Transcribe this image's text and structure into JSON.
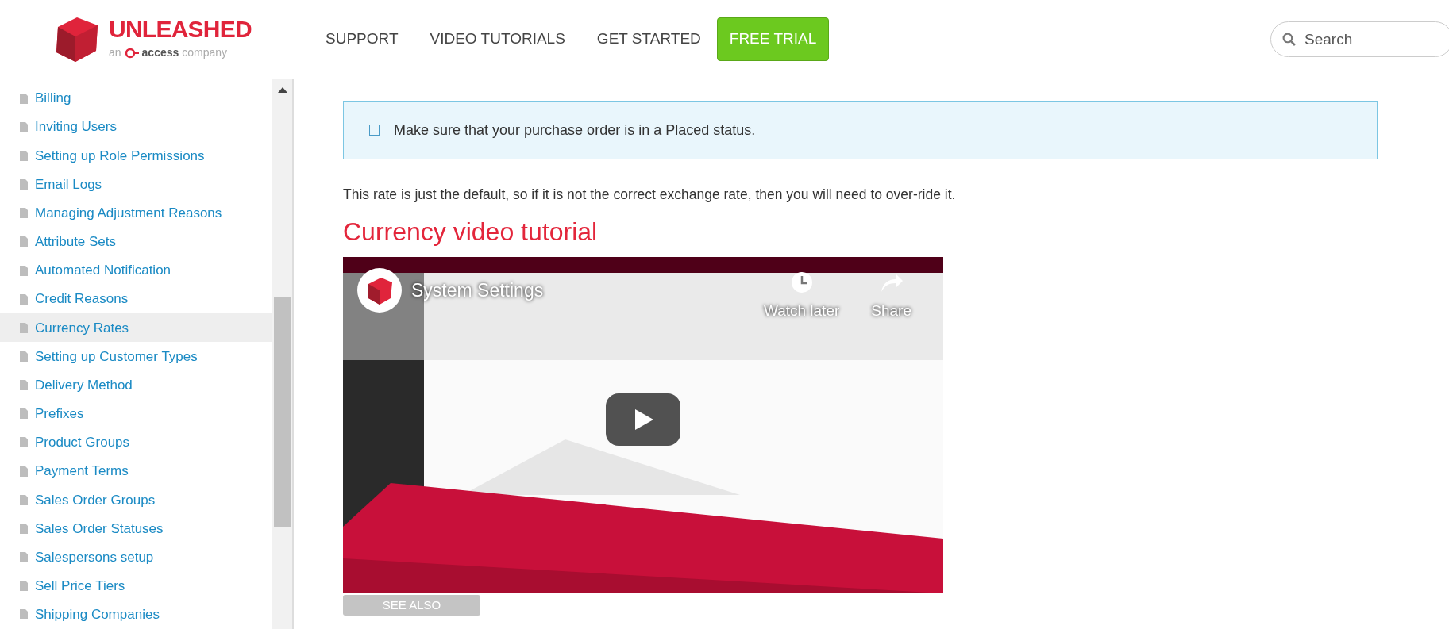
{
  "header": {
    "logo": {
      "name": "UNLEASHED",
      "tagline_pre": "an",
      "tagline_brand": "access",
      "tagline_post": "company"
    },
    "nav": [
      {
        "label": "SUPPORT",
        "kind": "link"
      },
      {
        "label": "VIDEO TUTORIALS",
        "kind": "link"
      },
      {
        "label": "GET STARTED",
        "kind": "link"
      },
      {
        "label": "FREE TRIAL",
        "kind": "cta"
      }
    ],
    "search": {
      "placeholder": "Search"
    }
  },
  "sidebar": {
    "items": [
      {
        "label": "Billing",
        "selected": false
      },
      {
        "label": "Inviting Users",
        "selected": false
      },
      {
        "label": "Setting up Role Permissions",
        "selected": false
      },
      {
        "label": "Email Logs",
        "selected": false
      },
      {
        "label": "Managing Adjustment Reasons",
        "selected": false
      },
      {
        "label": "Attribute Sets",
        "selected": false
      },
      {
        "label": "Automated Notification",
        "selected": false
      },
      {
        "label": "Credit Reasons",
        "selected": false
      },
      {
        "label": "Currency Rates",
        "selected": true
      },
      {
        "label": "Setting up Customer Types",
        "selected": false
      },
      {
        "label": "Delivery Method",
        "selected": false
      },
      {
        "label": "Prefixes",
        "selected": false
      },
      {
        "label": "Product Groups",
        "selected": false
      },
      {
        "label": "Payment Terms",
        "selected": false
      },
      {
        "label": "Sales Order Groups",
        "selected": false
      },
      {
        "label": "Sales Order Statuses",
        "selected": false
      },
      {
        "label": "Salespersons setup",
        "selected": false
      },
      {
        "label": "Sell Price Tiers",
        "selected": false
      },
      {
        "label": "Shipping Companies",
        "selected": false
      }
    ]
  },
  "content": {
    "callout": {
      "text": "Make sure that your purchase order is in a Placed status.",
      "checked": false
    },
    "paragraph": "This rate is just the default, so if it is not the correct exchange rate, then you will need to over-ride it.",
    "heading": "Currency video tutorial",
    "video": {
      "title": "System Settings",
      "actions": [
        {
          "label": "Watch later",
          "kind": "clock"
        },
        {
          "label": "Share",
          "kind": "share"
        }
      ]
    },
    "see_also": "SEE ALSO"
  }
}
